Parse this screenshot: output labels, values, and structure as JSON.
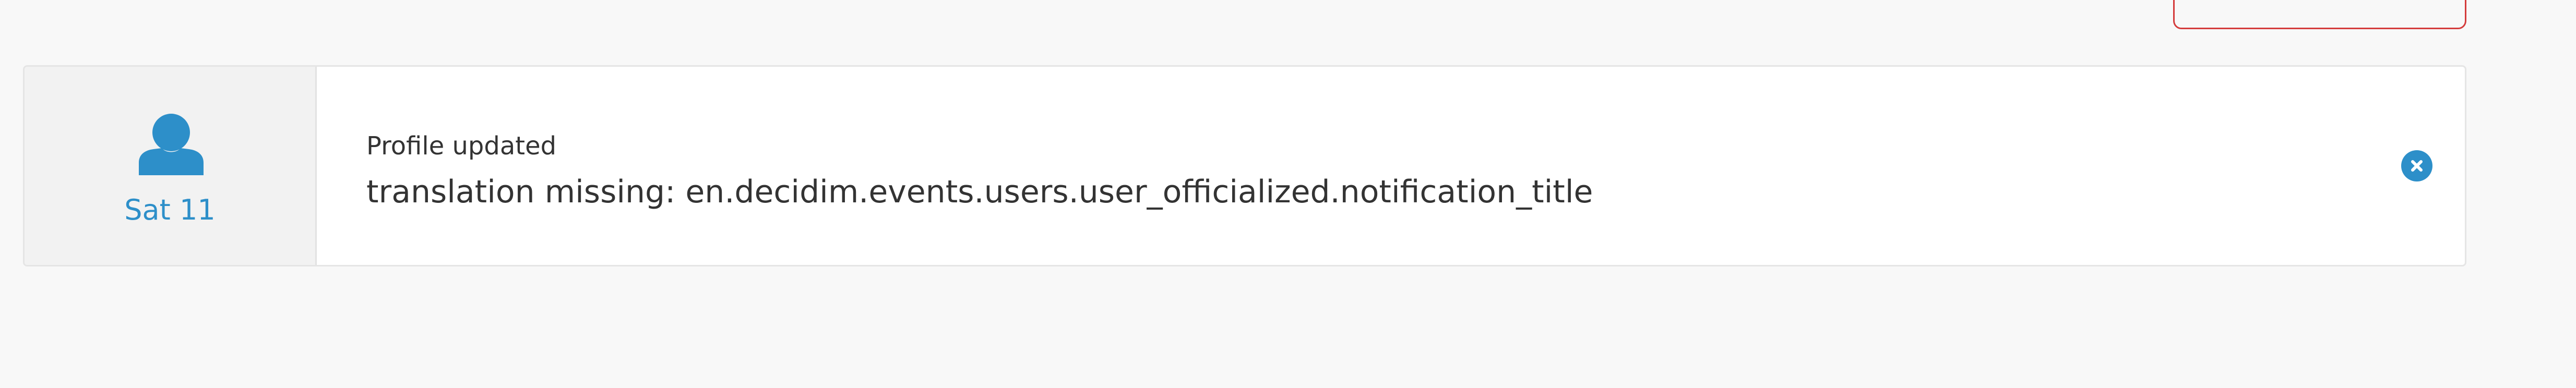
{
  "notification": {
    "date": "Sat 11",
    "subtitle": "Profile updated",
    "message": "translation missing: en.decidim.events.users.user_officialized.notification_title",
    "icon": "user-icon",
    "close_icon": "close-icon",
    "accent_color": "#2d8fc9"
  },
  "page": {
    "background_color": "#f8f8f8",
    "card_color": "#ffffff",
    "alert_border_color": "#d43c3c"
  }
}
